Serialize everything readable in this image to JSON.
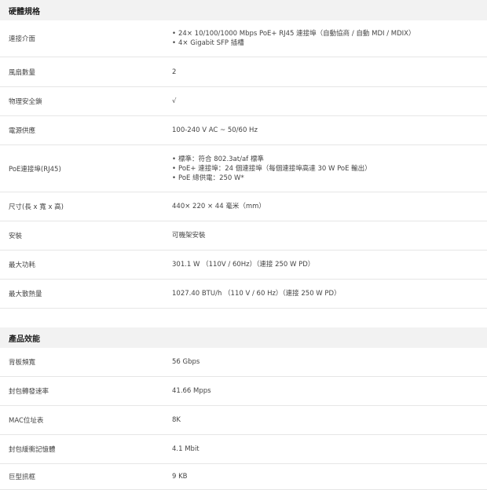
{
  "sections": [
    {
      "title": "硬體規格",
      "rows": [
        {
          "label": "連接介面",
          "bullets": [
            "24× 10/100/1000 Mbps PoE+ RJ45 連接埠（自動協商 / 自動 MDI / MDIX）",
            "4× Gigabit SFP 插槽"
          ]
        },
        {
          "label": "風扇數量",
          "value": "2"
        },
        {
          "label": "物理安全鎖",
          "value": "√"
        },
        {
          "label": "電源供應",
          "value": "100-240 V AC ~ 50/60 Hz"
        },
        {
          "label": "PoE連接埠(RJ45)",
          "bullets": [
            "標準：符合 802.3at/af 標準",
            "PoE+ 連接埠：24 個連接埠（每個連接埠高達 30 W PoE 輸出）",
            "PoE 總供電：250 W*"
          ]
        },
        {
          "label": "尺寸(長 x 寬 x 高)",
          "value": "440× 220 × 44 毫米（mm）"
        },
        {
          "label": "安裝",
          "value": "可機架安裝"
        },
        {
          "label": "最大功耗",
          "value": "301.1 W （110V / 60Hz）（連接 250 W PD）"
        },
        {
          "label": "最大散熱量",
          "value": "1027.40 BTU/h （110 V / 60 Hz）（連接 250 W PD）"
        }
      ]
    },
    {
      "title": "產品效能",
      "rows": [
        {
          "label": "背板頻寬",
          "value": "56 Gbps"
        },
        {
          "label": "封包轉發速率",
          "value": "41.66 Mpps"
        },
        {
          "label": "MAC位址表",
          "value": "8K"
        },
        {
          "label": "封包緩衝記憶體",
          "value": "4.1 Mbit"
        },
        {
          "label": "巨型訊框",
          "value": "9 KB"
        }
      ]
    }
  ]
}
